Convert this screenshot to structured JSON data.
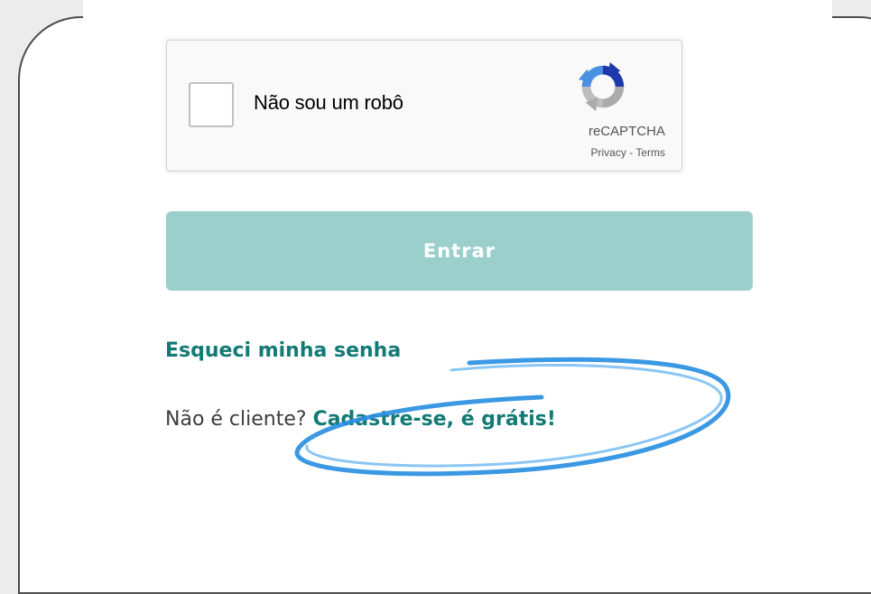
{
  "recaptcha": {
    "checkbox_label": "Não sou um robô",
    "brand": "reCAPTCHA",
    "privacy_link": "Privacy",
    "separator": "-",
    "terms_link": "Terms",
    "logo_icon": "recaptcha-logo-icon"
  },
  "login": {
    "submit_label": "Entrar",
    "forgot_password": "Esqueci minha senha",
    "signup_prompt": "Não é cliente?",
    "signup_link": "Cadastre-se, é grátis!"
  },
  "annotation": {
    "type": "hand-drawn ellipse highlight",
    "color": "#2a8fe0"
  },
  "colors": {
    "button_bg": "#9acfcc",
    "link": "#137a76",
    "frame_border": "#4d4d4d",
    "background": "#ececec"
  }
}
